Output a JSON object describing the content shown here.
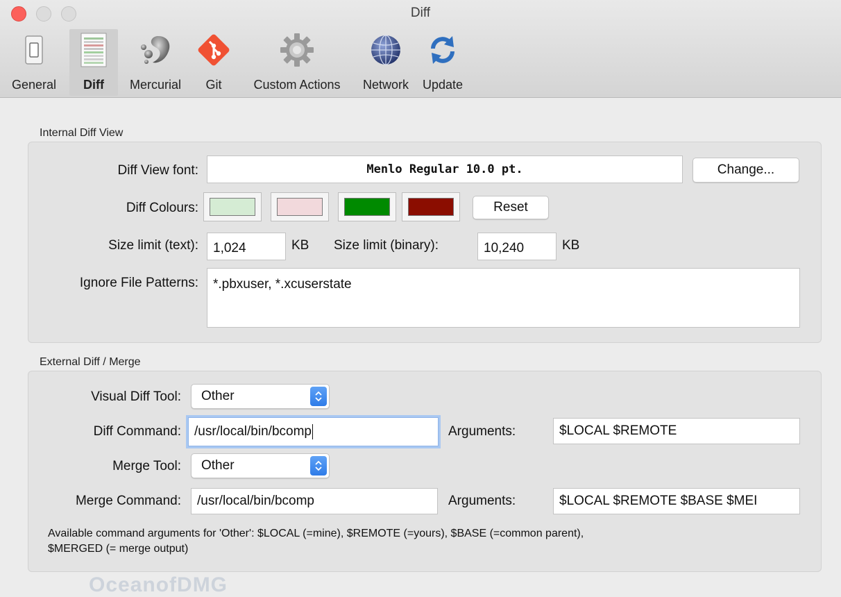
{
  "window": {
    "title": "Diff"
  },
  "toolbar": {
    "items": [
      {
        "label": "General",
        "icon": "switch-icon"
      },
      {
        "label": "Diff",
        "icon": "diff-document-icon",
        "selected": true
      },
      {
        "label": "Mercurial",
        "icon": "mercurial-icon"
      },
      {
        "label": "Git",
        "icon": "git-icon"
      },
      {
        "label": "Custom Actions",
        "icon": "gear-icon"
      },
      {
        "label": "Network",
        "icon": "globe-icon"
      },
      {
        "label": "Update",
        "icon": "refresh-icon"
      }
    ]
  },
  "internal": {
    "title": "Internal Diff View",
    "font_label": "Diff View font:",
    "font_value": "Menlo Regular 10.0 pt.",
    "change_button": "Change...",
    "colours_label": "Diff Colours:",
    "colours": [
      "#d5ecd4",
      "#f2d9dc",
      "#008a00",
      "#8b0d00"
    ],
    "reset_button": "Reset",
    "size_text_label": "Size limit (text):",
    "size_text_value": "1,024",
    "size_text_unit": "KB",
    "size_binary_label": "Size limit (binary):",
    "size_binary_value": "10,240",
    "size_binary_unit": "KB",
    "ignore_label": "Ignore File Patterns:",
    "ignore_value": "*.pbxuser, *.xcuserstate"
  },
  "external": {
    "title": "External Diff / Merge",
    "visual_tool_label": "Visual Diff Tool:",
    "visual_tool_value": "Other",
    "diff_command_label": "Diff Command:",
    "diff_command_value": "/usr/local/bin/bcomp",
    "diff_args_label": "Arguments:",
    "diff_args_value": "$LOCAL $REMOTE",
    "merge_tool_label": "Merge Tool:",
    "merge_tool_value": "Other",
    "merge_command_label": "Merge Command:",
    "merge_command_value": "/usr/local/bin/bcomp",
    "merge_args_label": "Arguments:",
    "merge_args_value": "$LOCAL $REMOTE $BASE $MEI",
    "help_line1": "Available command arguments for 'Other': $LOCAL (=mine), $REMOTE (=yours), $BASE (=common parent),",
    "help_line2": "$MERGED (= merge output)"
  },
  "watermark": "OceanofDMG"
}
